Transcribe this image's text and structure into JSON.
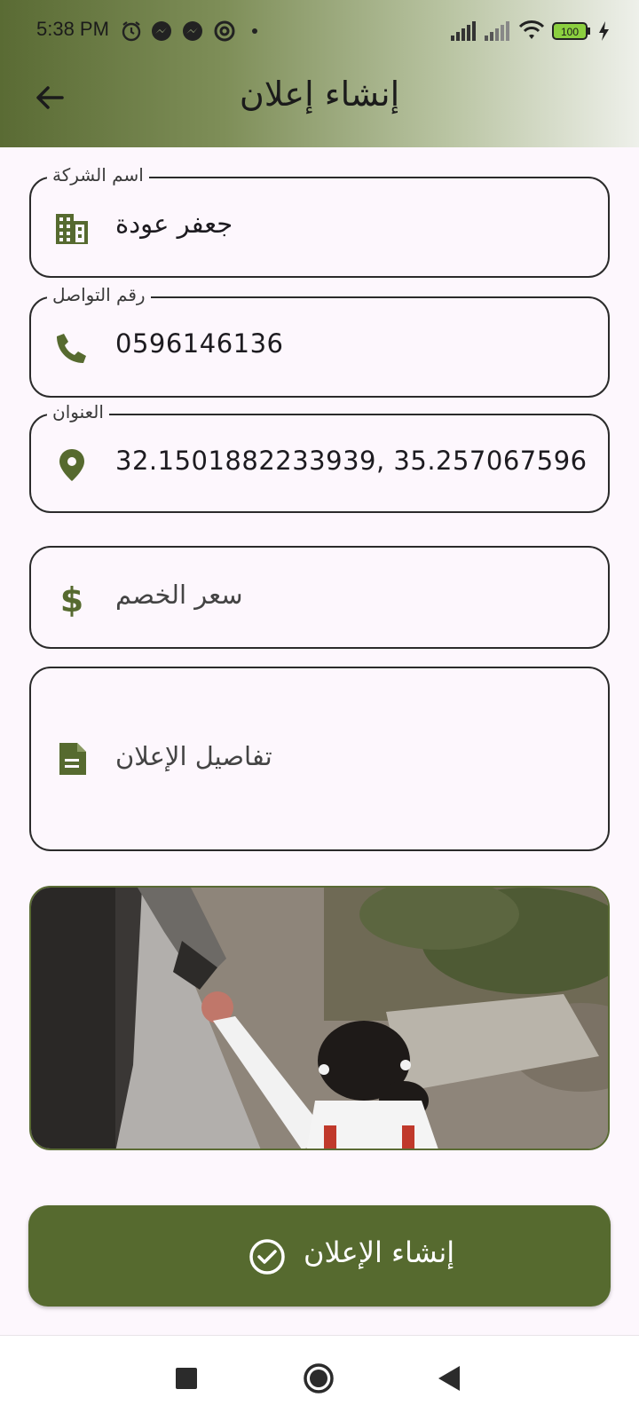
{
  "status_bar": {
    "time": "5:38 PM",
    "battery": "100",
    "icons": [
      "alarm-icon",
      "messenger-icon",
      "messenger-icon",
      "at-icon",
      "dot-icon",
      "signal-icon",
      "signal-icon",
      "wifi-icon",
      "battery-icon",
      "charging-icon"
    ]
  },
  "app_bar": {
    "title": "إنشاء إعلان",
    "back_icon": "arrow-back-icon"
  },
  "form": {
    "company_name": {
      "label": "اسم الشركة",
      "value": "جعفر عودة",
      "icon": "building-icon"
    },
    "contact_number": {
      "label": "رقم التواصل",
      "value": "0596146136",
      "icon": "phone-icon"
    },
    "address": {
      "label": "العنوان",
      "value": "32.1501882233939, 35.257067596",
      "icon": "location-pin-icon"
    },
    "discount_price": {
      "placeholder": "سعر الخصم",
      "icon": "dollar-icon"
    },
    "ad_details": {
      "placeholder": "تفاصيل الإعلان",
      "icon": "document-icon"
    }
  },
  "image": {
    "description_icon": "photo"
  },
  "create_button": {
    "label": "إنشاء الإعلان",
    "icon": "check-circle-icon"
  },
  "colors": {
    "accent": "#566a2f",
    "background": "#FDF7FD",
    "outline": "#2b2b2b"
  },
  "nav_bar": {
    "icons": [
      "recent-apps-icon",
      "home-icon",
      "back-icon"
    ]
  }
}
